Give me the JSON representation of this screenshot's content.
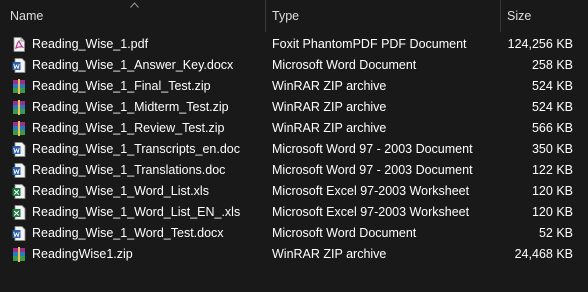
{
  "columns": {
    "name": "Name",
    "type": "Type",
    "size": "Size"
  },
  "colors": {
    "background": "#191919",
    "text": "#ffffff",
    "header_text": "#dedede",
    "divider": "#3a3a3a",
    "pdf_icon": "#b83a8a",
    "word_icon": "#2b5faa",
    "excel_icon": "#1d7a44",
    "zip_icon": "#9b2f8a"
  },
  "files": [
    {
      "name": "Reading_Wise_1.pdf",
      "type": "Foxit PhantomPDF PDF Document",
      "size": "124,256 KB",
      "icon": "pdf-icon"
    },
    {
      "name": "Reading_Wise_1_Answer_Key.docx",
      "type": "Microsoft Word Document",
      "size": "258 KB",
      "icon": "word-icon"
    },
    {
      "name": "Reading_Wise_1_Final_Test.zip",
      "type": "WinRAR ZIP archive",
      "size": "524 KB",
      "icon": "winrar-zip-icon"
    },
    {
      "name": "Reading_Wise_1_Midterm_Test.zip",
      "type": "WinRAR ZIP archive",
      "size": "524 KB",
      "icon": "winrar-zip-icon"
    },
    {
      "name": "Reading_Wise_1_Review_Test.zip",
      "type": "WinRAR ZIP archive",
      "size": "566 KB",
      "icon": "winrar-zip-icon"
    },
    {
      "name": "Reading_Wise_1_Transcripts_en.doc",
      "type": "Microsoft Word 97 - 2003 Document",
      "size": "350 KB",
      "icon": "word-icon"
    },
    {
      "name": "Reading_Wise_1_Translations.doc",
      "type": "Microsoft Word 97 - 2003 Document",
      "size": "122 KB",
      "icon": "word-icon"
    },
    {
      "name": "Reading_Wise_1_Word_List.xls",
      "type": "Microsoft Excel 97-2003 Worksheet",
      "size": "120 KB",
      "icon": "excel-icon"
    },
    {
      "name": "Reading_Wise_1_Word_List_EN_.xls",
      "type": "Microsoft Excel 97-2003 Worksheet",
      "size": "120 KB",
      "icon": "excel-icon"
    },
    {
      "name": "Reading_Wise_1_Word_Test.docx",
      "type": "Microsoft Word Document",
      "size": "52 KB",
      "icon": "word-icon"
    },
    {
      "name": "ReadingWise1.zip",
      "type": "WinRAR ZIP archive",
      "size": "24,468 KB",
      "icon": "winrar-zip-icon"
    }
  ]
}
